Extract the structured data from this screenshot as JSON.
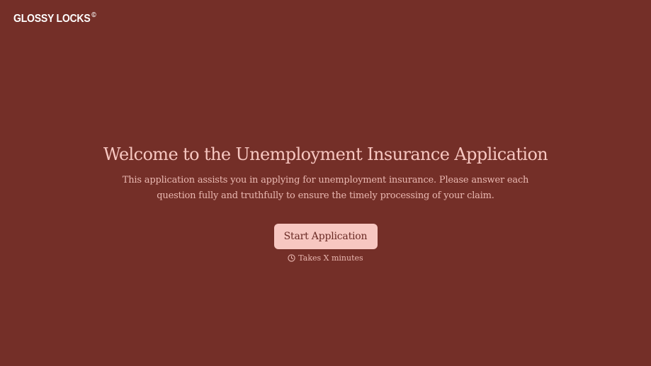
{
  "header": {
    "brand_name": "GLOSSY LOCKS",
    "brand_mark": "©"
  },
  "hero": {
    "title": "Welcome to the Unemployment Insurance Application",
    "description": "This application assists you in applying for unemployment insurance. Please answer each question fully and truthfully to ensure the timely processing of your claim.",
    "start_button_label": "Start Application",
    "duration_icon": "clock-icon",
    "duration_text": "Takes X minutes"
  },
  "colors": {
    "background": "#742f28",
    "accent": "#f7c7c1",
    "button_text": "#6a2a24"
  }
}
